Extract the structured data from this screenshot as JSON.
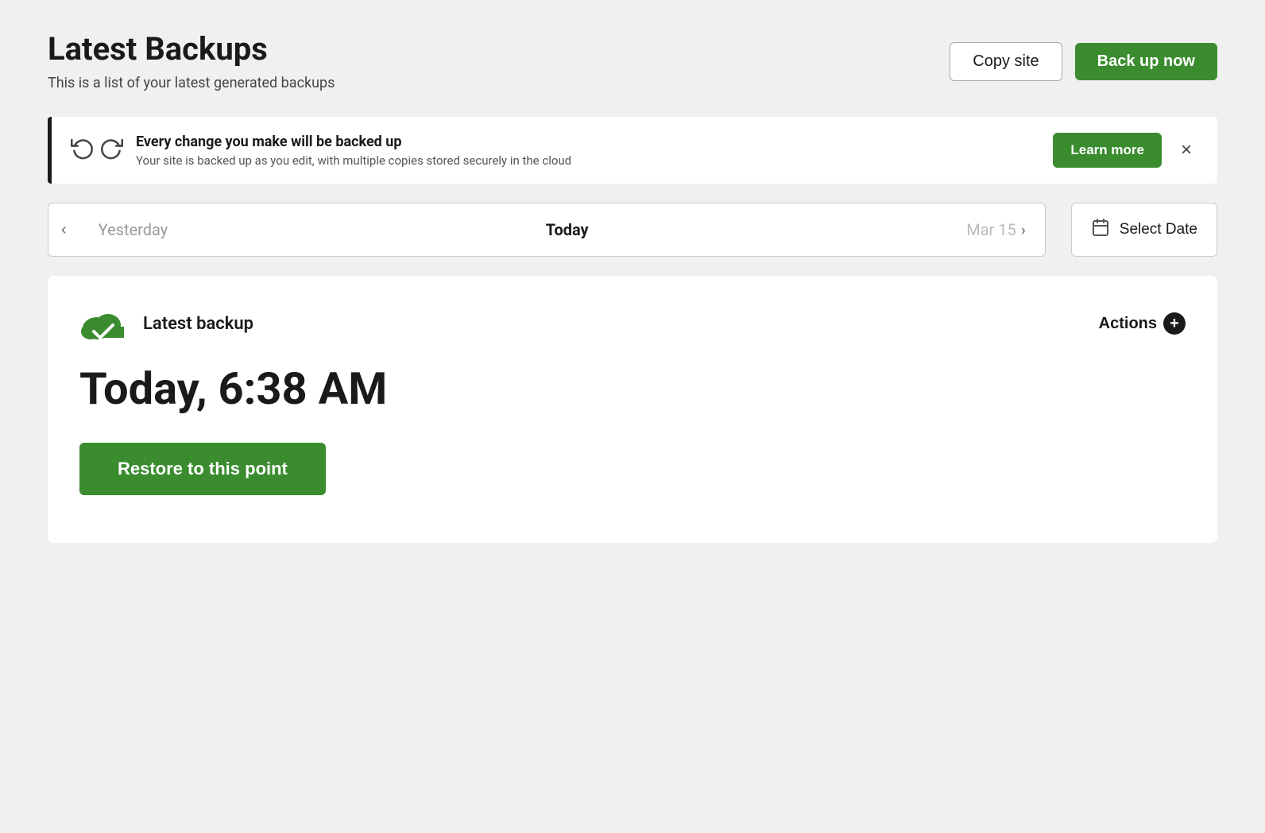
{
  "header": {
    "title": "Latest Backups",
    "subtitle": "This is a list of your latest generated backups",
    "copy_site_label": "Copy site",
    "back_up_now_label": "Back up now"
  },
  "info_banner": {
    "title": "Every change you make will be backed up",
    "subtitle": "Your site is backed up as you edit, with multiple copies stored securely in the cloud",
    "learn_more_label": "Learn more",
    "close_icon": "×"
  },
  "date_nav": {
    "previous_label": "Yesterday",
    "current_label": "Today",
    "next_label": "Mar 15",
    "select_date_label": "Select Date"
  },
  "backup_card": {
    "label": "Latest backup",
    "time": "Today, 6:38 AM",
    "actions_label": "Actions",
    "restore_label": "Restore to this point"
  },
  "icons": {
    "history1": "↺",
    "history2": "↺",
    "calendar": "📅",
    "chevron_left": "‹",
    "chevron_right": "›",
    "close": "×",
    "plus": "+"
  }
}
